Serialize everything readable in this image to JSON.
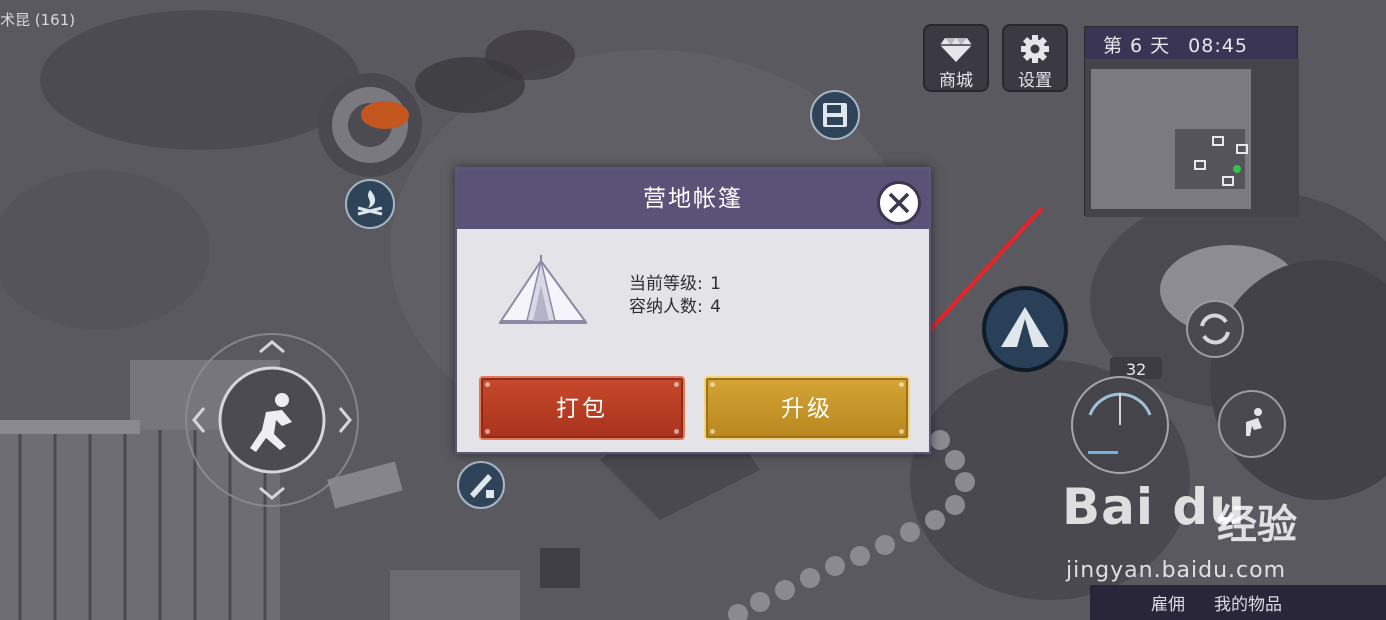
{
  "hud": {
    "top_left_label": "术昆 (161)",
    "shop_label": "商城",
    "settings_label": "设置",
    "day_label": "第 6 天",
    "time_label": "08:45",
    "ammo_count": "32",
    "bottom_items": [
      "雇佣",
      "我的物品"
    ]
  },
  "dialog": {
    "title": "营地帐篷",
    "level_label": "当前等级:",
    "level_value": "1",
    "capacity_label": "容纳人数:",
    "capacity_value": "4",
    "pack_label": "打包",
    "upgrade_label": "升级"
  },
  "watermark": {
    "logo_text": "Bai du",
    "chinese_text": "经验",
    "url": "jingyan.baidu.com"
  },
  "colors": {
    "dialog_header": "#5b5278",
    "pack_button": "#b5391f",
    "upgrade_button": "#c8982a",
    "annotation_arrow": "#e8232a"
  },
  "icons": [
    "diamond-icon",
    "gear-icon",
    "save-icon",
    "campfire-icon",
    "tent-icon",
    "saw-icon",
    "sprint-icon",
    "refresh-icon",
    "close-icon"
  ]
}
